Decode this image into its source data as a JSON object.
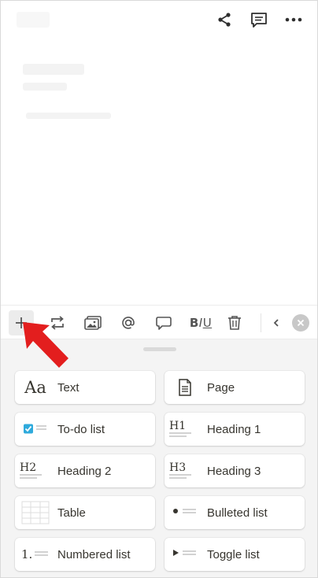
{
  "topbar": {
    "icons": [
      "share-icon",
      "comment-icon",
      "more-icon"
    ]
  },
  "toolbar": {
    "biu": {
      "b": "B",
      "i": "I",
      "u": "U"
    },
    "icons": [
      "plus-icon",
      "turn-into-icon",
      "image-icon",
      "mention-icon",
      "comment-icon",
      "text-style-icon",
      "trash-icon",
      "chevron-left-icon",
      "close-icon"
    ]
  },
  "blocks": [
    {
      "label": "Text",
      "icon": "Aa",
      "icon_name": "text-icon"
    },
    {
      "label": "Page",
      "icon": "",
      "icon_name": "page-icon"
    },
    {
      "label": "To-do list",
      "icon": "",
      "icon_name": "todo-icon"
    },
    {
      "label": "Heading 1",
      "icon": "H1",
      "icon_name": "heading1-icon"
    },
    {
      "label": "Heading 2",
      "icon": "H2",
      "icon_name": "heading2-icon"
    },
    {
      "label": "Heading 3",
      "icon": "H3",
      "icon_name": "heading3-icon"
    },
    {
      "label": "Table",
      "icon": "",
      "icon_name": "table-icon"
    },
    {
      "label": "Bulleted list",
      "icon": "",
      "icon_name": "bulleted-list-icon"
    },
    {
      "label": "Numbered list",
      "icon": "1.",
      "icon_name": "numbered-list-icon"
    },
    {
      "label": "Toggle list",
      "icon": "",
      "icon_name": "toggle-list-icon"
    }
  ],
  "colors": {
    "accent_check": "#2eaadc",
    "arrow": "#e31e1e",
    "drawer_bg": "#f4f4f4"
  }
}
